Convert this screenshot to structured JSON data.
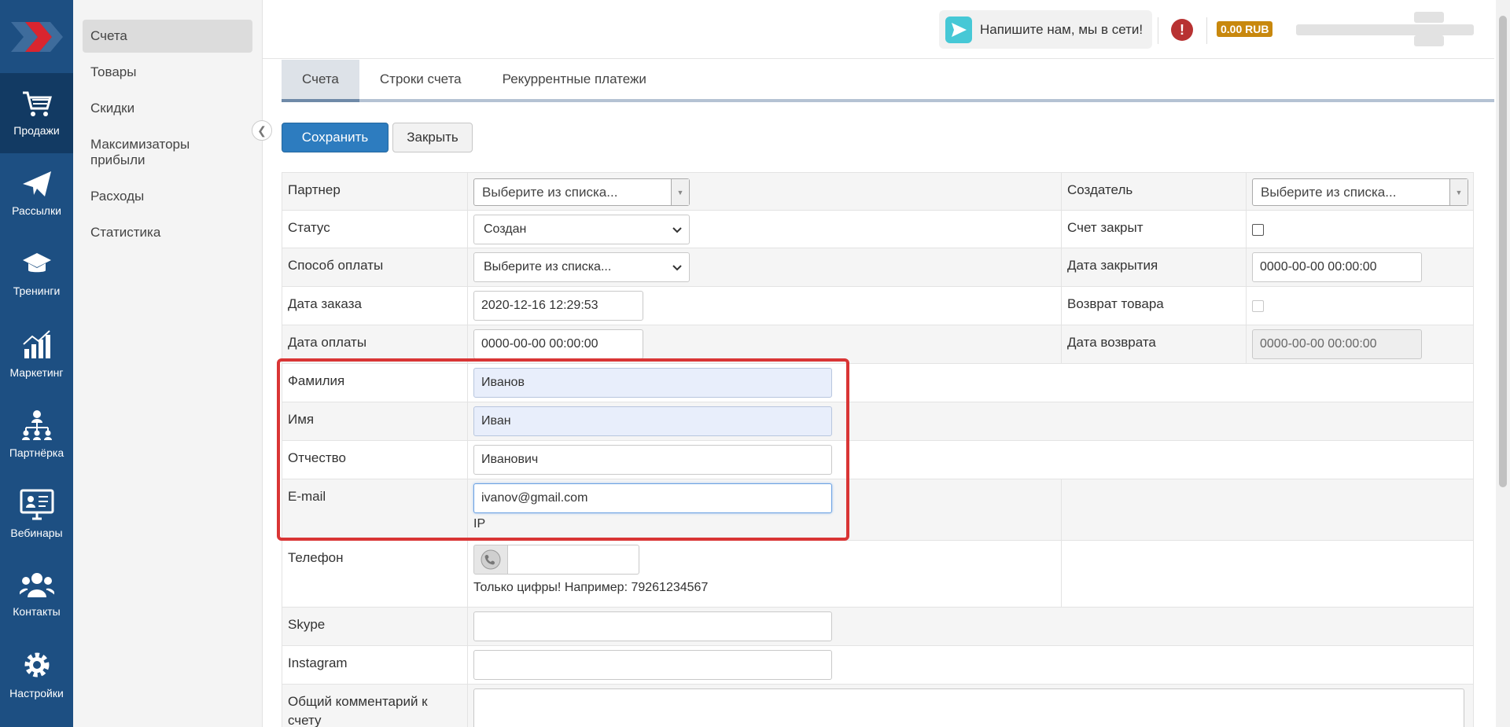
{
  "rail": {
    "items": [
      {
        "label": "Продажи",
        "icon": "cart-icon",
        "active": true
      },
      {
        "label": "Рассылки",
        "icon": "paper-plane-icon",
        "active": false
      },
      {
        "label": "Тренинги",
        "icon": "graduation-cap-icon",
        "active": false
      },
      {
        "label": "Маркетинг",
        "icon": "bar-chart-icon",
        "active": false
      },
      {
        "label": "Партнёрка",
        "icon": "hierarchy-icon",
        "active": false
      },
      {
        "label": "Вебинары",
        "icon": "webinar-monitor-icon",
        "active": false
      },
      {
        "label": "Контакты",
        "icon": "users-icon",
        "active": false
      },
      {
        "label": "Настройки",
        "icon": "gear-icon",
        "active": false
      }
    ]
  },
  "subnav": {
    "items": [
      {
        "label": "Счета",
        "active": true
      },
      {
        "label": "Товары",
        "active": false
      },
      {
        "label": "Скидки",
        "active": false
      },
      {
        "label": "Максимизаторы прибыли",
        "active": false
      },
      {
        "label": "Расходы",
        "active": false
      },
      {
        "label": "Статистика",
        "active": false
      }
    ]
  },
  "topbar": {
    "chat_label": "Напишите нам, мы в сети!",
    "alert_glyph": "!",
    "balance": "0.00 RUB"
  },
  "tabs": [
    {
      "label": "Счета",
      "active": true
    },
    {
      "label": "Строки счета",
      "active": false
    },
    {
      "label": "Рекуррентные платежи",
      "active": false
    }
  ],
  "buttons": {
    "save": "Сохранить",
    "close": "Закрыть"
  },
  "form": {
    "partner": {
      "label": "Партнер",
      "value": "Выберите из списка..."
    },
    "creator": {
      "label": "Создатель",
      "value": "Выберите из списка..."
    },
    "status": {
      "label": "Статус",
      "value": "Создан"
    },
    "closed": {
      "label": "Счет закрыт",
      "checked": false
    },
    "payment_method": {
      "label": "Способ оплаты",
      "value": "Выберите из списка..."
    },
    "close_date": {
      "label": "Дата закрытия",
      "value": "0000-00-00 00:00:00"
    },
    "order_date": {
      "label": "Дата заказа",
      "value": "2020-12-16 12:29:53"
    },
    "return": {
      "label": "Возврат товара",
      "checked": false
    },
    "payment_date": {
      "label": "Дата оплаты",
      "value": "0000-00-00 00:00:00"
    },
    "return_date": {
      "label": "Дата возврата",
      "value": "0000-00-00 00:00:00"
    },
    "last_name": {
      "label": "Фамилия",
      "value": "Иванов"
    },
    "first_name": {
      "label": "Имя",
      "value": "Иван"
    },
    "middle_name": {
      "label": "Отчество",
      "value": "Иванович"
    },
    "email": {
      "label": "E-mail",
      "value": "ivanov@gmail.com",
      "ip_label": "IP"
    },
    "phone": {
      "label": "Телефон",
      "value": "",
      "hint": "Только цифры! Например: 79261234567"
    },
    "skype": {
      "label": "Skype",
      "value": ""
    },
    "instagram": {
      "label": "Instagram",
      "value": ""
    },
    "comment": {
      "label": "Общий комментарий к счету",
      "value": ""
    }
  },
  "colors": {
    "rail_bg": "#1d4f82",
    "primary": "#2d7cbf",
    "highlight": "#d93535",
    "balance_badge": "#c8880e"
  }
}
